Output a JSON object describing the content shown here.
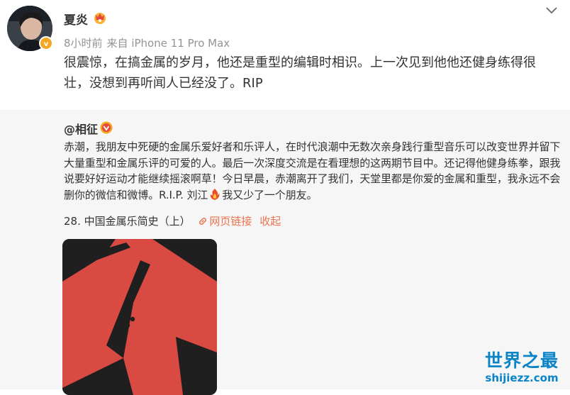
{
  "post": {
    "author": "夏炎",
    "time": "8小时前",
    "source": "来自 iPhone 11 Pro Max",
    "text": "很震惊，在搞金属的岁月，他还是重型的编辑时相识。上一次见到他他还健身练得很壮，没想到再听闻人已经没了。RIP"
  },
  "repost": {
    "author": "@相征",
    "text_main": "赤潮，我朋友中死硬的金属乐爱好者和乐评人，在时代浪潮中无数次亲身践行重型音乐可以改变世界并留下大量重型和金属乐评的可爱的人。最后一次深度交流是在看理想的这两期节目中。还记得他健身练拳，跟我说要好好运动才能继续摇滚啊草！今日早晨，赤潮离开了我们，天堂里都是你爱的金属和重型，我永远不会删你的微信和微博。R.I.P. 刘江",
    "text_tail": "我又少了一个朋友。",
    "program_title": "28. 中国金属乐简史（上）",
    "link_label": "网页链接",
    "collapse_label": "收起"
  },
  "icons": {
    "verified": "verified-badge-icon",
    "member": "member-crown-icon",
    "chevron": "chevron-down-icon",
    "fire": "fire-emoji-icon",
    "link": "link-icon"
  },
  "colors": {
    "link": "#eb7350",
    "verified": "#f5a623",
    "repost_bg": "#f6f6f6",
    "watermark": "#0a84c6"
  },
  "watermark": {
    "title": "世界之最",
    "url": "shijiezz.com"
  }
}
